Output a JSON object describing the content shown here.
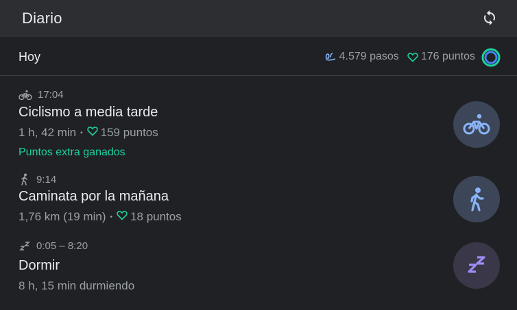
{
  "app": {
    "title": "Diario"
  },
  "summary": {
    "day": "Hoy",
    "steps": "4.579 pasos",
    "points": "176 puntos"
  },
  "entries": [
    {
      "time": "17:04",
      "title": "Ciclismo a media tarde",
      "duration": "1 h, 42 min",
      "points": "159 puntos",
      "extra": "Puntos extra ganados",
      "icon": "bike-icon"
    },
    {
      "time": "9:14",
      "title": "Caminata por la mañana",
      "duration": "1,76 km (19 min)",
      "points": "18 puntos",
      "icon": "walk-icon"
    },
    {
      "time": "0:05 – 8:20",
      "title": "Dormir",
      "duration": "8 h, 15 min durmiendo",
      "icon": "sleep-icon"
    }
  ],
  "colors": {
    "background": "#202124",
    "appbar": "#2d2e31",
    "accent_green": "#1dd1a1",
    "accent_blue": "#8ab4f8",
    "sleep_purple": "#9b8cf5"
  }
}
